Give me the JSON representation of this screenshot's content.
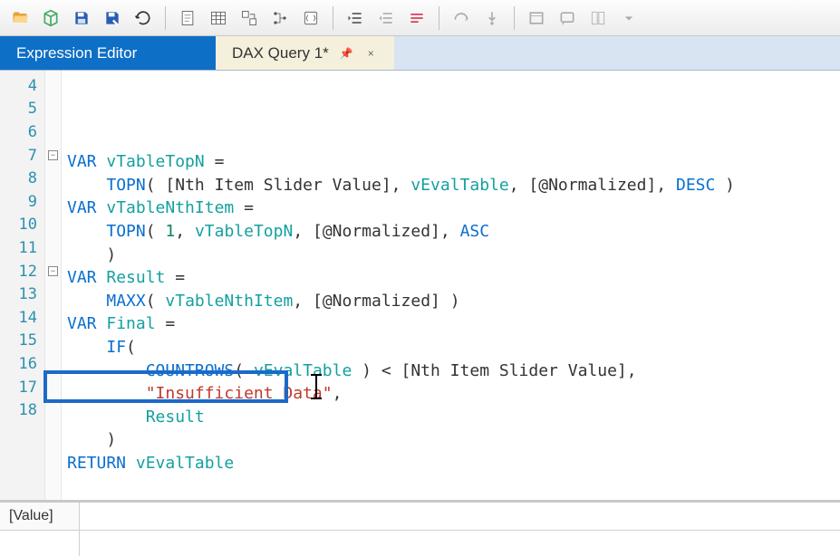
{
  "toolbar": {
    "icons": [
      "folder-open-icon",
      "cube-icon",
      "save-icon",
      "save-as-icon",
      "refresh-icon",
      "sep",
      "page-icon",
      "table-icon",
      "pivot-icon",
      "tree-icon",
      "script-icon",
      "sep",
      "indent-icon",
      "outdent-icon",
      "comment-icon",
      "sep",
      "step-over-icon",
      "step-into-icon",
      "sep",
      "window-icon",
      "message-icon",
      "layout-icon",
      "dropdown-icon"
    ]
  },
  "tabs": {
    "expression_editor": "Expression Editor",
    "query": "DAX Query 1*",
    "pin": "📌",
    "close": "×"
  },
  "code": {
    "lines": [
      4,
      5,
      6,
      7,
      8,
      9,
      10,
      11,
      12,
      13,
      14,
      15,
      16,
      17,
      18
    ],
    "fold": {
      "7": "-",
      "12": "-"
    },
    "tokens": {
      "4": [
        {
          "c": "tok-kw",
          "t": "VAR "
        },
        {
          "c": "tok-var",
          "t": "vTableTopN"
        },
        {
          "c": "tok-op",
          "t": " ="
        }
      ],
      "5": [
        {
          "c": "",
          "t": "    "
        },
        {
          "c": "tok-fn",
          "t": "TOPN"
        },
        {
          "c": "tok-op",
          "t": "( "
        },
        {
          "c": "tok-meas",
          "t": "[Nth Item Slider Value]"
        },
        {
          "c": "tok-op",
          "t": ", "
        },
        {
          "c": "tok-varg",
          "t": "vEvalTable"
        },
        {
          "c": "tok-op",
          "t": ", "
        },
        {
          "c": "tok-meas",
          "t": "[@Normalized]"
        },
        {
          "c": "tok-op",
          "t": ", "
        },
        {
          "c": "tok-kw",
          "t": "DESC"
        },
        {
          "c": "tok-op",
          "t": " )"
        }
      ],
      "6": [
        {
          "c": "tok-kw",
          "t": "VAR "
        },
        {
          "c": "tok-var",
          "t": "vTableNthItem"
        },
        {
          "c": "tok-op",
          "t": " ="
        }
      ],
      "7": [
        {
          "c": "",
          "t": "    "
        },
        {
          "c": "tok-fn",
          "t": "TOPN"
        },
        {
          "c": "tok-op",
          "t": "( "
        },
        {
          "c": "tok-num",
          "t": "1"
        },
        {
          "c": "tok-op",
          "t": ", "
        },
        {
          "c": "tok-varg",
          "t": "vTableTopN"
        },
        {
          "c": "tok-op",
          "t": ", "
        },
        {
          "c": "tok-meas",
          "t": "[@Normalized]"
        },
        {
          "c": "tok-op",
          "t": ", "
        },
        {
          "c": "tok-kw",
          "t": "ASC"
        }
      ],
      "8": [
        {
          "c": "tok-op",
          "t": "    )"
        }
      ],
      "9": [
        {
          "c": "tok-kw",
          "t": "VAR "
        },
        {
          "c": "tok-var",
          "t": "Result"
        },
        {
          "c": "tok-op",
          "t": " ="
        }
      ],
      "10": [
        {
          "c": "",
          "t": "    "
        },
        {
          "c": "tok-fn",
          "t": "MAXX"
        },
        {
          "c": "tok-op",
          "t": "( "
        },
        {
          "c": "tok-varg",
          "t": "vTableNthItem"
        },
        {
          "c": "tok-op",
          "t": ", "
        },
        {
          "c": "tok-meas",
          "t": "[@Normalized]"
        },
        {
          "c": "tok-op",
          "t": " )"
        }
      ],
      "11": [
        {
          "c": "tok-kw",
          "t": "VAR "
        },
        {
          "c": "tok-var",
          "t": "Final"
        },
        {
          "c": "tok-op",
          "t": " ="
        }
      ],
      "12": [
        {
          "c": "",
          "t": "    "
        },
        {
          "c": "tok-fn",
          "t": "IF"
        },
        {
          "c": "tok-op",
          "t": "("
        }
      ],
      "13": [
        {
          "c": "",
          "t": "        "
        },
        {
          "c": "tok-fn",
          "t": "COUNTROWS"
        },
        {
          "c": "tok-op",
          "t": "( "
        },
        {
          "c": "tok-varg",
          "t": "vEvalTable"
        },
        {
          "c": "tok-op",
          "t": " ) < "
        },
        {
          "c": "tok-meas",
          "t": "[Nth Item Slider Value]"
        },
        {
          "c": "tok-op",
          "t": ","
        }
      ],
      "14": [
        {
          "c": "",
          "t": "        "
        },
        {
          "c": "tok-str",
          "t": "\"Insufficient Data\""
        },
        {
          "c": "tok-op",
          "t": ","
        }
      ],
      "15": [
        {
          "c": "",
          "t": "        "
        },
        {
          "c": "tok-varg",
          "t": "Result"
        }
      ],
      "16": [
        {
          "c": "tok-op",
          "t": "    )"
        }
      ],
      "17": [
        {
          "c": "tok-kw",
          "t": "RETURN "
        },
        {
          "c": "tok-varg",
          "t": "vEvalTable"
        }
      ],
      "18": [
        {
          "c": "",
          "t": ""
        }
      ]
    }
  },
  "results": {
    "column": "[Value]"
  }
}
